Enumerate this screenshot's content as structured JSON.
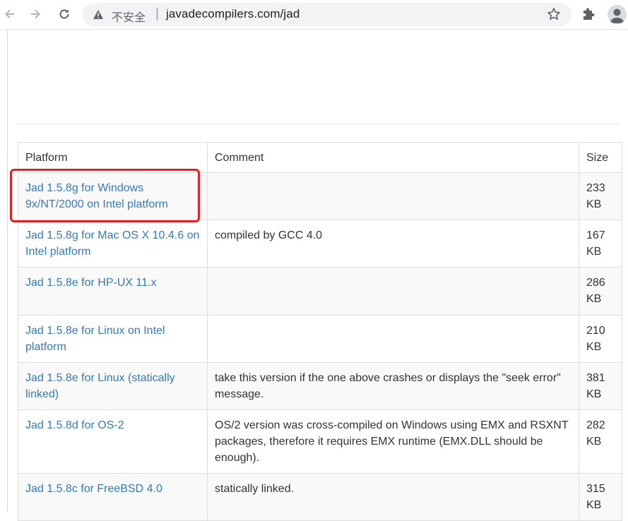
{
  "browser": {
    "security_label": "不安全",
    "separator": "|",
    "url": "javadecompilers.com/jad"
  },
  "table": {
    "headers": {
      "platform": "Platform",
      "comment": "Comment",
      "size": "Size"
    },
    "rows": [
      {
        "platform": "Jad 1.5.8g for Windows 9x/NT/2000 on Intel platform",
        "comment": "",
        "size": "233 KB"
      },
      {
        "platform": "Jad 1.5.8g for Mac OS X 10.4.6 on Intel platform",
        "comment": "compiled by GCC 4.0",
        "size": "167 KB"
      },
      {
        "platform": "Jad 1.5.8e for HP-UX 11.x",
        "comment": "",
        "size": "286 KB"
      },
      {
        "platform": "Jad 1.5.8e for Linux on Intel platform",
        "comment": "",
        "size": "210 KB"
      },
      {
        "platform": "Jad 1.5.8e for Linux (statically linked)",
        "comment": "take this version if the one above crashes or displays the \"seek error\" message.",
        "size": "381 KB"
      },
      {
        "platform": "Jad 1.5.8d for OS-2",
        "comment": "OS/2 version was cross-compiled on Windows using EMX and RSXNT packages, therefore it requires EMX runtime (EMX.DLL should be enough).",
        "size": "282 KB"
      },
      {
        "platform": "Jad 1.5.8c for FreeBSD 4.0",
        "comment": "statically linked.",
        "size": "315 KB"
      }
    ]
  },
  "colors": {
    "link": "#337ab7",
    "highlight": "#ee1c1c"
  }
}
